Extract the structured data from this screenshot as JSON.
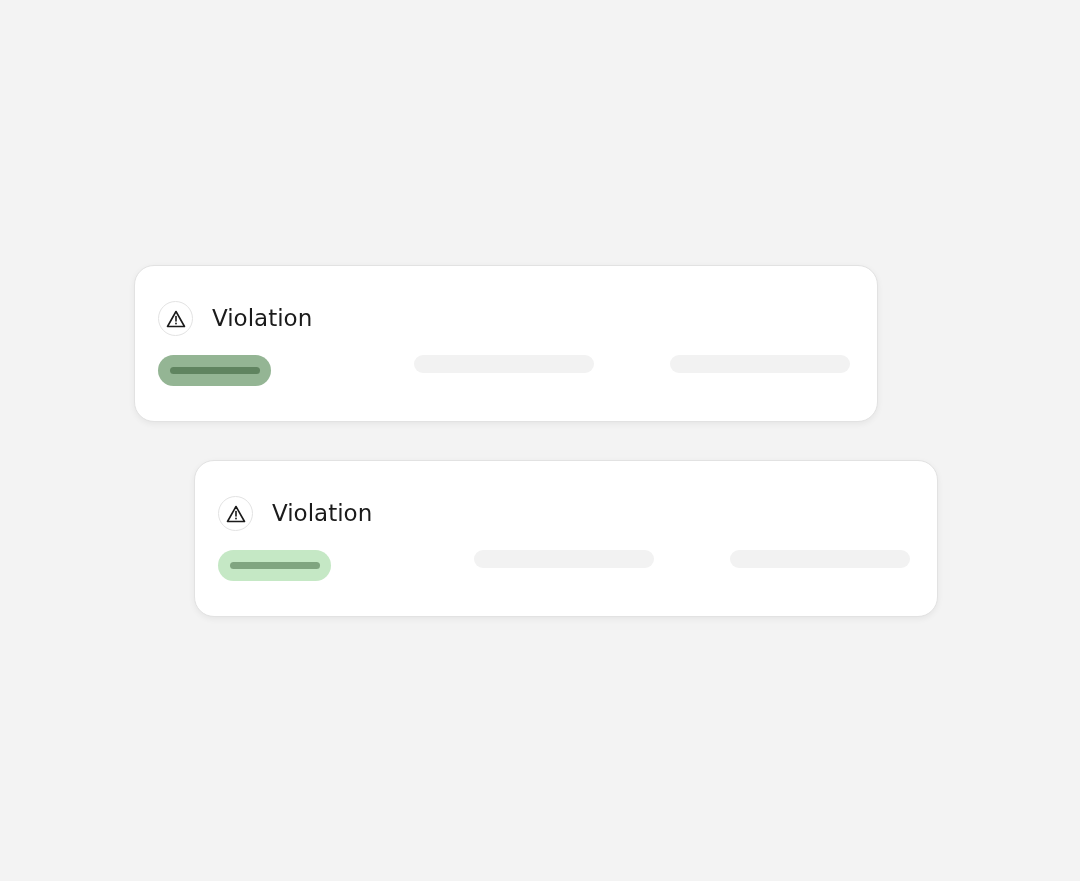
{
  "cards": [
    {
      "title": "Violation",
      "color": "#94b594"
    },
    {
      "title": "Violation",
      "color": "#c5e8c5"
    }
  ]
}
